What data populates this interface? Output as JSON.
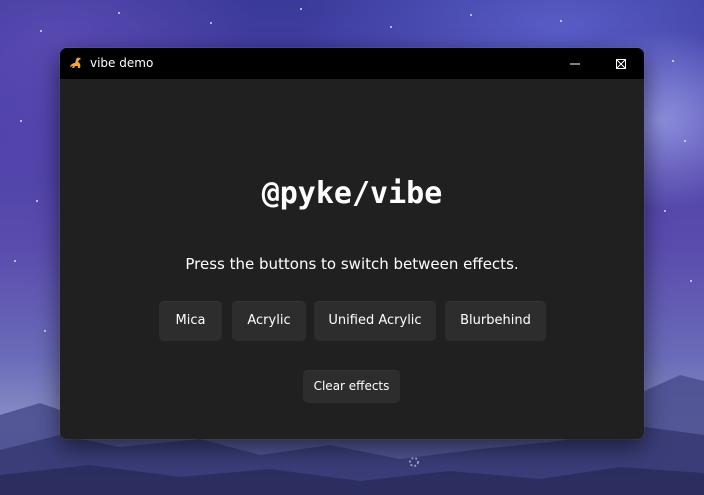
{
  "window": {
    "title": "vibe demo",
    "app_icon": "dinosaur-icon",
    "controls": [
      "minimize-icon",
      "maximize-icon",
      "close-icon"
    ]
  },
  "main": {
    "heading": "@pyke/vibe",
    "subtitle": "Press the buttons to switch between effects.",
    "effect_buttons": [
      {
        "label": "Mica"
      },
      {
        "label": "Acrylic"
      },
      {
        "label": "Unified Acrylic"
      },
      {
        "label": "Blurbehind"
      }
    ],
    "clear_button": "Clear effects"
  },
  "colors": {
    "window_bg": "#202020",
    "titlebar_bg": "#000000",
    "button_bg": "#2d2d2d",
    "text": "#ffffff"
  }
}
